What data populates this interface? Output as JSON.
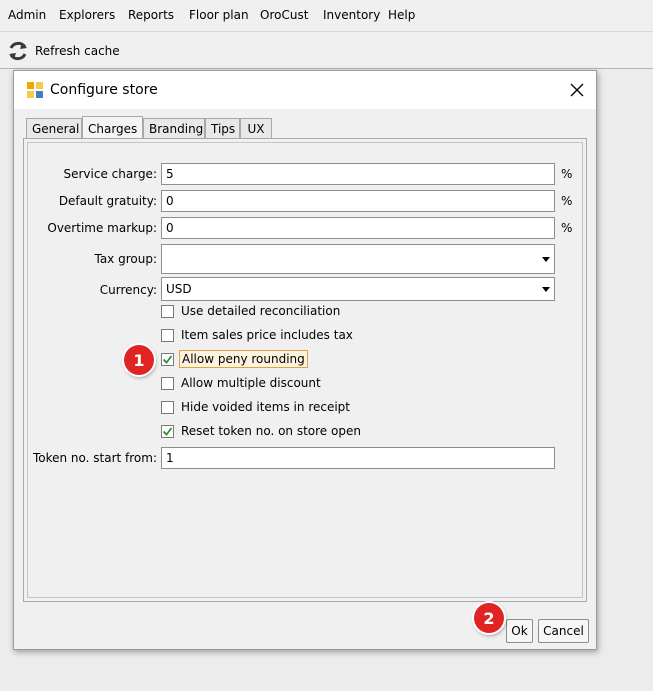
{
  "menu": {
    "items": [
      "Admin",
      "Explorers",
      "Reports",
      "Floor plan",
      "OroCust",
      "Inventory",
      "Help"
    ]
  },
  "toolbar": {
    "refresh_label": "Refresh cache",
    "refresh_icon": "refresh-icon"
  },
  "dialog": {
    "title": "Configure store",
    "icon": "app-icon",
    "close_icon": "close-icon",
    "tabs": [
      {
        "label": "General",
        "active": false
      },
      {
        "label": "Charges",
        "active": true
      },
      {
        "label": "Branding",
        "active": false
      },
      {
        "label": "Tips",
        "active": false
      },
      {
        "label": "UX",
        "active": false
      }
    ],
    "fields": {
      "service_charge": {
        "label": "Service charge:",
        "value": "5",
        "unit": "%"
      },
      "default_gratuity": {
        "label": "Default gratuity:",
        "value": "0",
        "unit": "%"
      },
      "overtime_markup": {
        "label": "Overtime markup:",
        "value": "0",
        "unit": "%"
      },
      "tax_group": {
        "label": "Tax group:",
        "value": ""
      },
      "currency": {
        "label": "Currency:",
        "value": "USD"
      },
      "token_start": {
        "label": "Token no. start from:",
        "value": "1"
      }
    },
    "checkboxes": [
      {
        "label": "Use detailed reconciliation",
        "checked": false
      },
      {
        "label": "Item sales price includes tax",
        "checked": false
      },
      {
        "label": "Allow peny rounding",
        "checked": true
      },
      {
        "label": "Allow multiple discount",
        "checked": false
      },
      {
        "label": "Hide voided items in receipt",
        "checked": false
      },
      {
        "label": "Reset token no. on store open",
        "checked": true
      }
    ],
    "ok_label": "Ok",
    "cancel_label": "Cancel"
  },
  "annotations": {
    "step1": "1",
    "step2": "2",
    "color": "#e02424"
  },
  "colors": {
    "check": "#2e8b2e",
    "focus_border": "#e2a23c"
  }
}
